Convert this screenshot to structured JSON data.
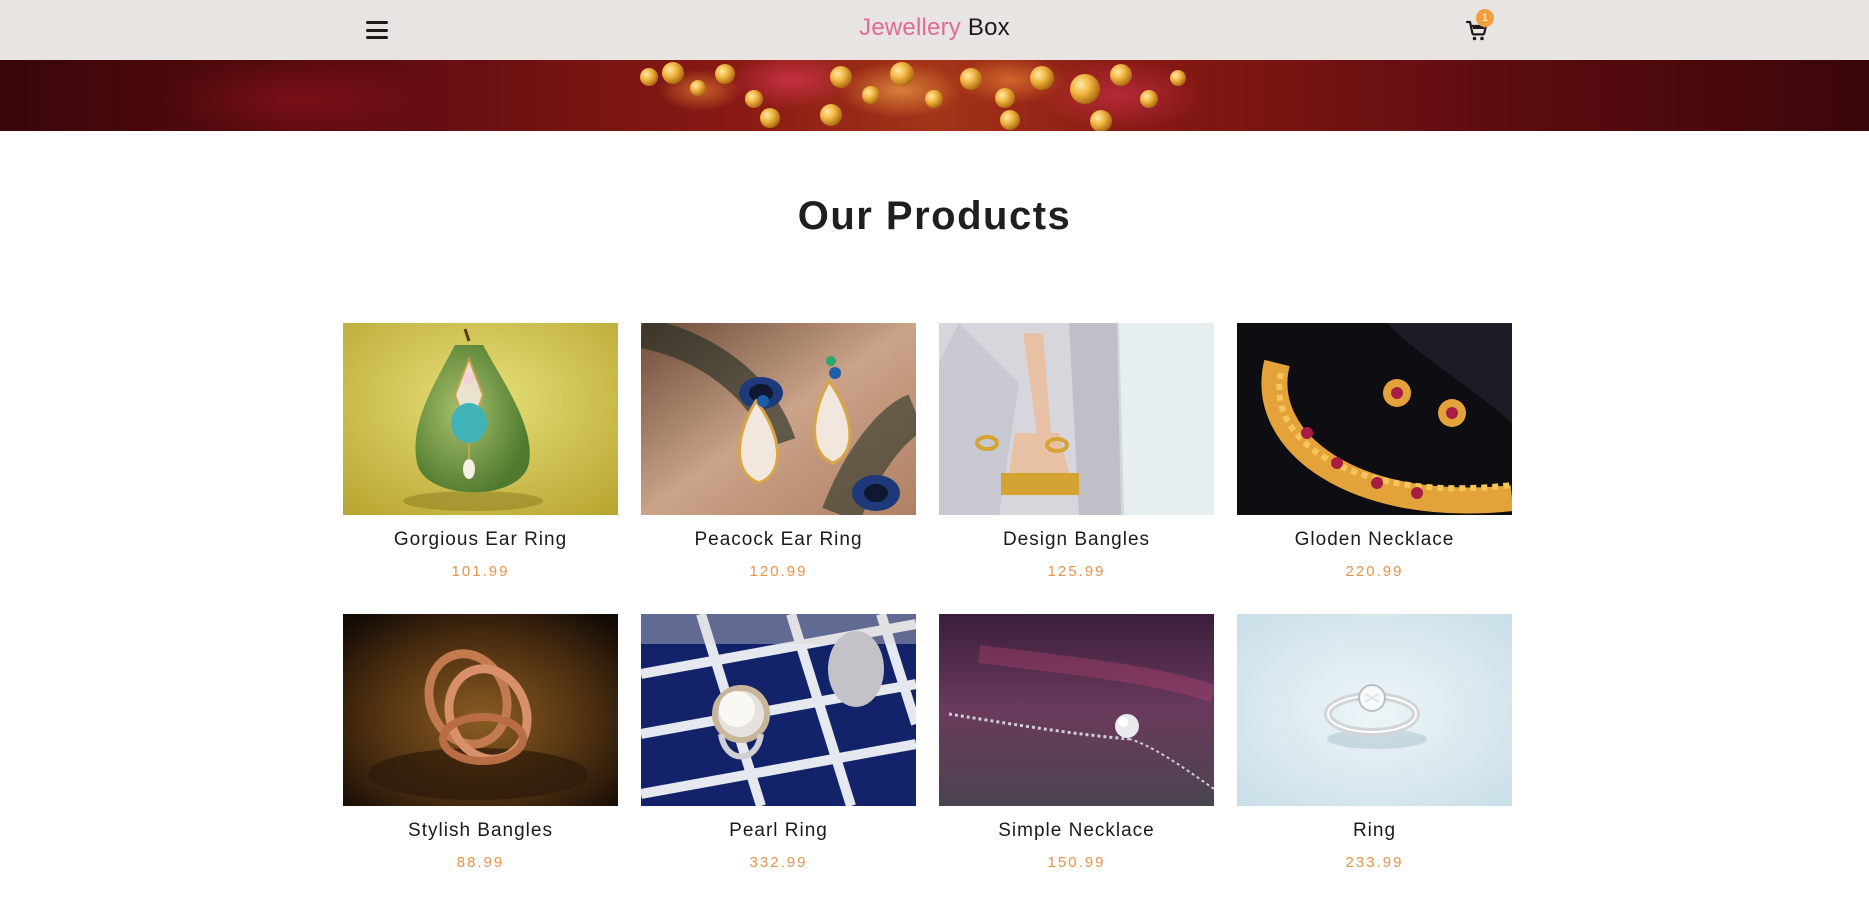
{
  "navbar": {
    "brand_part1": "Jewellery",
    "brand_part2": "Box",
    "menu_icon": "hamburger-menu-icon",
    "cart_icon": "shopping-cart-icon",
    "cart_count": "1",
    "brand_accent_color": "#e06c93",
    "background_color": "#e8e4e1"
  },
  "hero": {
    "image": "gold-jewellery-banner-image"
  },
  "products_section": {
    "title": "Our Products",
    "price_color": "#e8934c",
    "items": [
      {
        "name": "Gorgious Ear Ring",
        "price": "101.99",
        "image": "ear-ring-on-pear-image"
      },
      {
        "name": "Peacock Ear Ring",
        "price": "120.99",
        "image": "peacock-ear-ring-image"
      },
      {
        "name": "Design Bangles",
        "price": "125.99",
        "image": "bangles-model-image"
      },
      {
        "name": "Gloden Necklace",
        "price": "220.99",
        "image": "golden-necklace-image"
      },
      {
        "name": "Stylish Bangles",
        "price": "88.99",
        "image": "copper-rings-image"
      },
      {
        "name": "Pearl Ring",
        "price": "332.99",
        "image": "pearl-ring-image"
      },
      {
        "name": "Simple Necklace",
        "price": "150.99",
        "image": "simple-necklace-image"
      },
      {
        "name": "Ring",
        "price": "233.99",
        "image": "diamond-ring-image"
      }
    ]
  }
}
